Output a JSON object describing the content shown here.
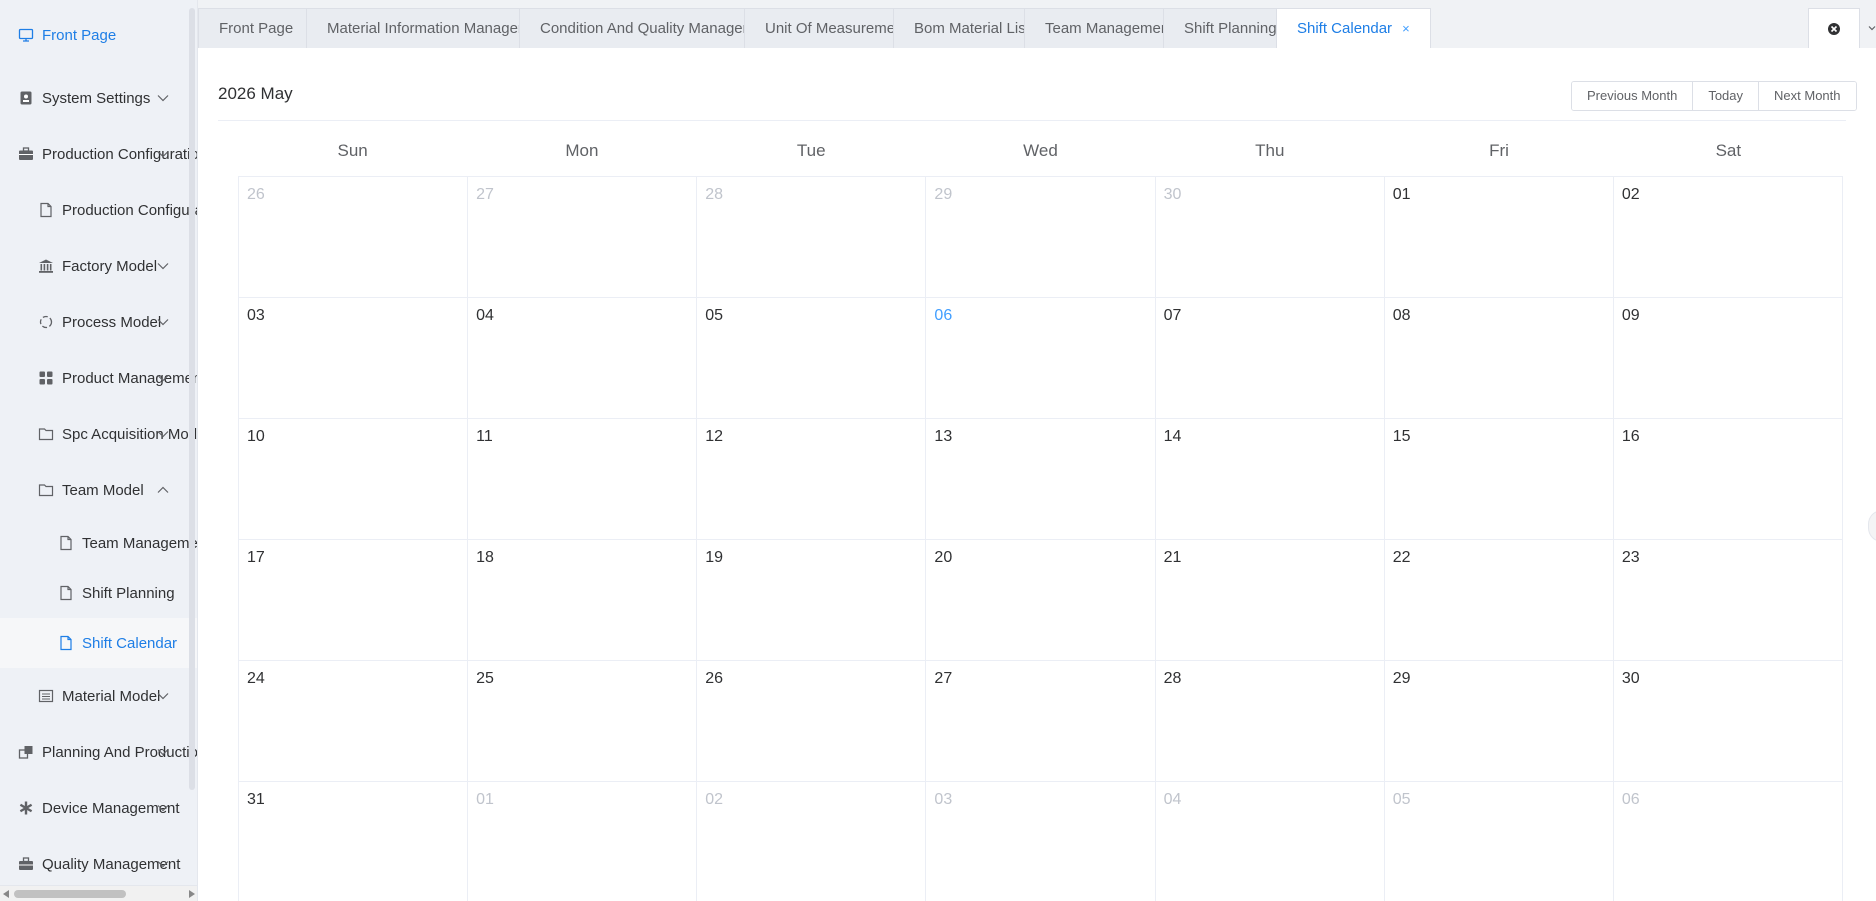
{
  "sidebar": {
    "items": [
      {
        "name": "front-page",
        "label": "Front Page",
        "level": 1,
        "icon": "monitor-icon",
        "active": true,
        "chevron": "none"
      },
      {
        "name": "system-settings",
        "label": "System Settings",
        "level": 1,
        "icon": "badge-icon",
        "chevron": "down"
      },
      {
        "name": "production-configuration",
        "label": "Production Configuration",
        "level": 1,
        "icon": "briefcase-icon",
        "chevron": "down"
      },
      {
        "name": "production-configuration-page",
        "label": "Production Configuration",
        "level": 2,
        "icon": "document-icon",
        "chevron": "none"
      },
      {
        "name": "factory-model",
        "label": "Factory Model",
        "level": 2,
        "icon": "bank-icon",
        "chevron": "down"
      },
      {
        "name": "process-model",
        "label": "Process Model",
        "level": 2,
        "icon": "cycle-icon",
        "chevron": "down"
      },
      {
        "name": "product-management",
        "label": "Product Management",
        "level": 2,
        "icon": "grid-icon",
        "chevron": "down"
      },
      {
        "name": "spc-acquisition-model",
        "label": "Spc Acquisition Model",
        "level": 2,
        "icon": "folder-icon",
        "chevron": "down"
      },
      {
        "name": "team-model",
        "label": "Team Model",
        "level": 2,
        "icon": "folder-icon",
        "chevron": "up"
      },
      {
        "name": "team-management",
        "label": "Team Management",
        "level": 3,
        "icon": "document-icon",
        "chevron": "none"
      },
      {
        "name": "shift-planning",
        "label": "Shift Planning",
        "level": 3,
        "icon": "document-icon",
        "chevron": "none"
      },
      {
        "name": "shift-calendar",
        "label": "Shift Calendar",
        "level": 3,
        "icon": "document-icon",
        "chevron": "none",
        "selected": true
      },
      {
        "name": "material-model",
        "label": "Material Model",
        "level": 2,
        "icon": "list-icon",
        "chevron": "down"
      },
      {
        "name": "planning-and-production",
        "label": "Planning And Production",
        "level": 1,
        "icon": "windows-icon",
        "chevron": "down"
      },
      {
        "name": "device-management",
        "label": "Device Management",
        "level": 1,
        "icon": "asterisk-icon",
        "chevron": "down"
      },
      {
        "name": "quality-management",
        "label": "Quality Management",
        "level": 1,
        "icon": "toolbox-icon",
        "chevron": "down"
      }
    ]
  },
  "tabs": [
    {
      "label": "Front Page"
    },
    {
      "label": "Material Information Management"
    },
    {
      "label": "Condition And Quality Management"
    },
    {
      "label": "Unit Of Measurement"
    },
    {
      "label": "Bom Material List"
    },
    {
      "label": "Team Management"
    },
    {
      "label": "Shift Planning"
    },
    {
      "label": "Shift Calendar",
      "active": true,
      "close": "×"
    }
  ],
  "tab_controls": {
    "close_all_icon": "close-circle-icon",
    "more_icon": "chevron-down-icon"
  },
  "calendar": {
    "title": "2026 May",
    "buttons": {
      "prev": "Previous Month",
      "today": "Today",
      "next": "Next Month"
    },
    "weekdays": [
      "Sun",
      "Mon",
      "Tue",
      "Wed",
      "Thu",
      "Fri",
      "Sat"
    ],
    "weeks": [
      [
        {
          "d": "26",
          "other": true
        },
        {
          "d": "27",
          "other": true
        },
        {
          "d": "28",
          "other": true
        },
        {
          "d": "29",
          "other": true
        },
        {
          "d": "30",
          "other": true
        },
        {
          "d": "01"
        },
        {
          "d": "02"
        }
      ],
      [
        {
          "d": "03"
        },
        {
          "d": "04"
        },
        {
          "d": "05"
        },
        {
          "d": "06",
          "today": true
        },
        {
          "d": "07"
        },
        {
          "d": "08"
        },
        {
          "d": "09"
        }
      ],
      [
        {
          "d": "10"
        },
        {
          "d": "11"
        },
        {
          "d": "12"
        },
        {
          "d": "13"
        },
        {
          "d": "14"
        },
        {
          "d": "15"
        },
        {
          "d": "16"
        }
      ],
      [
        {
          "d": "17"
        },
        {
          "d": "18"
        },
        {
          "d": "19"
        },
        {
          "d": "20"
        },
        {
          "d": "21"
        },
        {
          "d": "22"
        },
        {
          "d": "23"
        }
      ],
      [
        {
          "d": "24"
        },
        {
          "d": "25"
        },
        {
          "d": "26"
        },
        {
          "d": "27"
        },
        {
          "d": "28"
        },
        {
          "d": "29"
        },
        {
          "d": "30"
        }
      ],
      [
        {
          "d": "31"
        },
        {
          "d": "01",
          "other": true
        },
        {
          "d": "02",
          "other": true
        },
        {
          "d": "03",
          "other": true
        },
        {
          "d": "04",
          "other": true
        },
        {
          "d": "05",
          "other": true
        },
        {
          "d": "06",
          "other": true
        }
      ]
    ]
  },
  "colors": {
    "accent": "#1e7ee6",
    "today": "#409eff",
    "muted_day": "#c0c4cc"
  }
}
